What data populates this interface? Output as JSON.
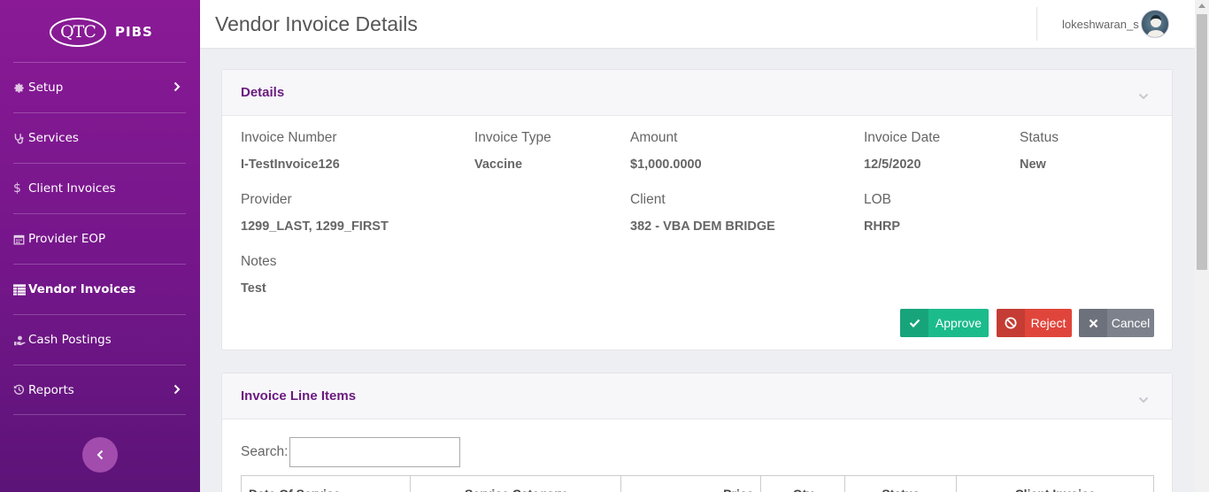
{
  "brand": {
    "logo_text": "QTC",
    "product": "PIBS"
  },
  "sidebar": {
    "items": [
      {
        "label": "Setup"
      },
      {
        "label": "Services"
      },
      {
        "label": "Client Invoices"
      },
      {
        "label": "Provider EOP"
      },
      {
        "label": "Vendor Invoices"
      },
      {
        "label": "Cash Postings"
      },
      {
        "label": "Reports"
      }
    ],
    "active_item": "Vendor Invoices"
  },
  "header": {
    "title": "Vendor Invoice Details",
    "username": "lokeshwaran_s"
  },
  "details": {
    "title": "Details",
    "fields": {
      "invoice_number": {
        "label": "Invoice Number",
        "value": "I-TestInvoice126"
      },
      "invoice_type": {
        "label": "Invoice Type",
        "value": "Vaccine"
      },
      "amount": {
        "label": "Amount",
        "value": "$1,000.0000"
      },
      "invoice_date": {
        "label": "Invoice Date",
        "value": "12/5/2020"
      },
      "status": {
        "label": "Status",
        "value": "New"
      },
      "provider": {
        "label": "Provider",
        "value": "1299_LAST, 1299_FIRST"
      },
      "client": {
        "label": "Client",
        "value": "382 - VBA DEM BRIDGE"
      },
      "lob": {
        "label": "LOB",
        "value": "RHRP"
      },
      "notes": {
        "label": "Notes",
        "value": "Test"
      }
    },
    "actions": {
      "approve": "Approve",
      "reject": "Reject",
      "cancel": "Cancel"
    }
  },
  "line_items": {
    "title": "Invoice Line Items",
    "search_label": "Search:",
    "search_value": "",
    "columns": [
      "Date Of Service",
      "Service Category",
      "Price",
      "Qty",
      "Status",
      "Client Invoice"
    ]
  },
  "colors": {
    "sidebar": "#7a1690",
    "accent_title": "#6a1a7e",
    "approve": "#1cbb8c",
    "reject": "#e0453b",
    "cancel": "#7d818c"
  },
  "icons": {
    "sidebar": [
      "gear-icon",
      "stethoscope-icon",
      "dollar-icon",
      "calendar-icon",
      "table-icon",
      "hand-money-icon",
      "history-icon"
    ]
  }
}
